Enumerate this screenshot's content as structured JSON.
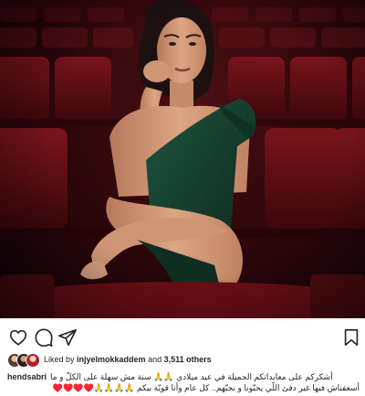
{
  "post": {
    "image_alt": "Portrait of a woman in a green off-shoulder dress seated in a theater with red seats",
    "colors": {
      "seat_red": "#6a1016",
      "dress_green": "#163b2b",
      "skin": "#d49a78",
      "hair": "#1c1110"
    }
  },
  "actions": {
    "like_icon": "heart-outline-icon",
    "comment_icon": "comment-bubble-icon",
    "share_icon": "paper-plane-icon",
    "save_icon": "bookmark-icon"
  },
  "likes": {
    "prefix": "Liked by ",
    "user": "injyelmokkaddem",
    "middle": " and ",
    "count": "3,511 others"
  },
  "caption": {
    "username": "hendsabri",
    "line1": "أشكركم على معايداتكم الجميلة في عيد ميلادي 🙏🙏 سنة مش سهلة على الكلّ و ما",
    "line2": "أسعفناش فيها غير دفئ اللّي يحبّونا و نحبّهم.. كل عام وأنا قويّة بيكم 🙏🙏🙏🙏♥️♥️♥️♥️"
  }
}
